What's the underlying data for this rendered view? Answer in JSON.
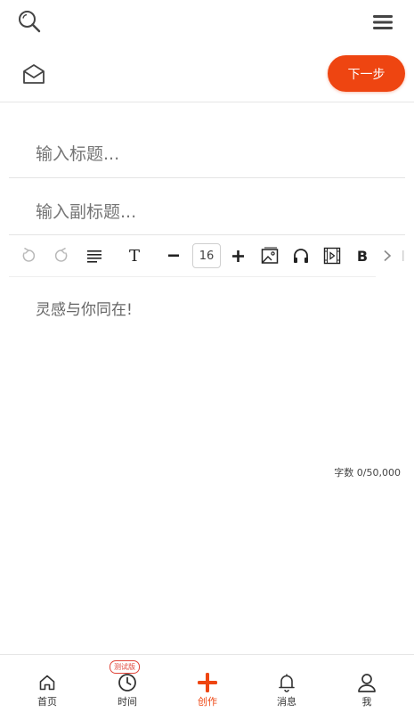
{
  "header": {
    "search_icon": "search-icon",
    "menu_icon": "hamburger-menu-icon"
  },
  "subheader": {
    "drafts_icon": "open-envelope-icon",
    "next_label": "下一步",
    "accent": "#ee4511"
  },
  "form": {
    "title_placeholder": "输入标题...",
    "subtitle_placeholder": "输入副标题..."
  },
  "toolbar": {
    "icons": [
      "undo-icon",
      "redo-icon",
      "align-icon",
      "text-style-icon",
      "decrease-font-icon",
      "increase-font-icon",
      "image-icon",
      "audio-icon",
      "video-icon",
      "bold-icon",
      "more-right-icon"
    ],
    "font_size": "16",
    "text_style_glyph": "T",
    "bold_glyph": "B"
  },
  "editor": {
    "placeholder": "灵感与你同在!",
    "counter": "字数 0/50,000"
  },
  "tabs": [
    {
      "label": "首页",
      "icon": "home-icon"
    },
    {
      "label": "时间",
      "icon": "clock-icon",
      "badge": "测试版"
    },
    {
      "label": "创作",
      "icon": "plus-icon",
      "active": true
    },
    {
      "label": "消息",
      "icon": "bell-icon"
    },
    {
      "label": "我",
      "icon": "person-icon"
    }
  ]
}
